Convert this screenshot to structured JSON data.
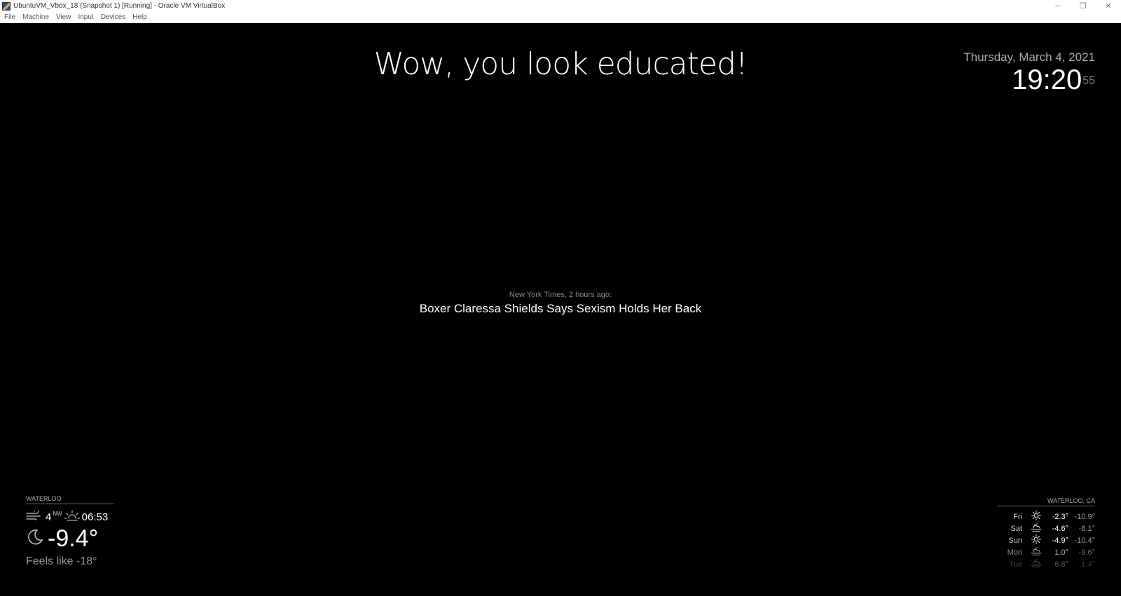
{
  "window": {
    "title": "UbuntuVM_Vbox_18 (Snapshot 1) [Running] - Oracle VM VirtualBox",
    "controls": {
      "minimize": "─",
      "restore": "❐",
      "close": "✕"
    }
  },
  "menu": [
    "File",
    "Machine",
    "View",
    "Input",
    "Devices",
    "Help"
  ],
  "compliment": "Wow, you look educated!",
  "clock": {
    "date": "Thursday, March 4, 2021",
    "time": "19:20",
    "seconds": "55"
  },
  "news": {
    "source": "New York Times, 2 hours ago:",
    "headline": "Boxer Claressa Shields Says Sexism Holds Her Back"
  },
  "current_weather": {
    "location": "WATERLOO",
    "wind_speed": "4",
    "wind_direction": "NW",
    "sun_time": "06:53",
    "temperature": "-9.4°",
    "feels_like": "Feels like -18°",
    "icons": {
      "wind": "wind-icon",
      "sunrise": "sunrise-icon",
      "condition": "night-clear-icon"
    }
  },
  "forecast": {
    "location": "WATERLOO, CA",
    "days": [
      {
        "day": "Fri",
        "icon": "sun",
        "max": "-2.3°",
        "min": "-10.9°",
        "opacity": 1.0
      },
      {
        "day": "Sat",
        "icon": "cloudy",
        "max": "-4.6°",
        "min": "-8.1°",
        "opacity": 1.0
      },
      {
        "day": "Sun",
        "icon": "sun",
        "max": "-4.9°",
        "min": "-10.4°",
        "opacity": 1.0
      },
      {
        "day": "Mon",
        "icon": "cloudy",
        "max": "1.0°",
        "min": "-9.6°",
        "opacity": 0.7
      },
      {
        "day": "Tue",
        "icon": "cloudy",
        "max": "6.8°",
        "min": "1.4°",
        "opacity": 0.35
      }
    ]
  }
}
